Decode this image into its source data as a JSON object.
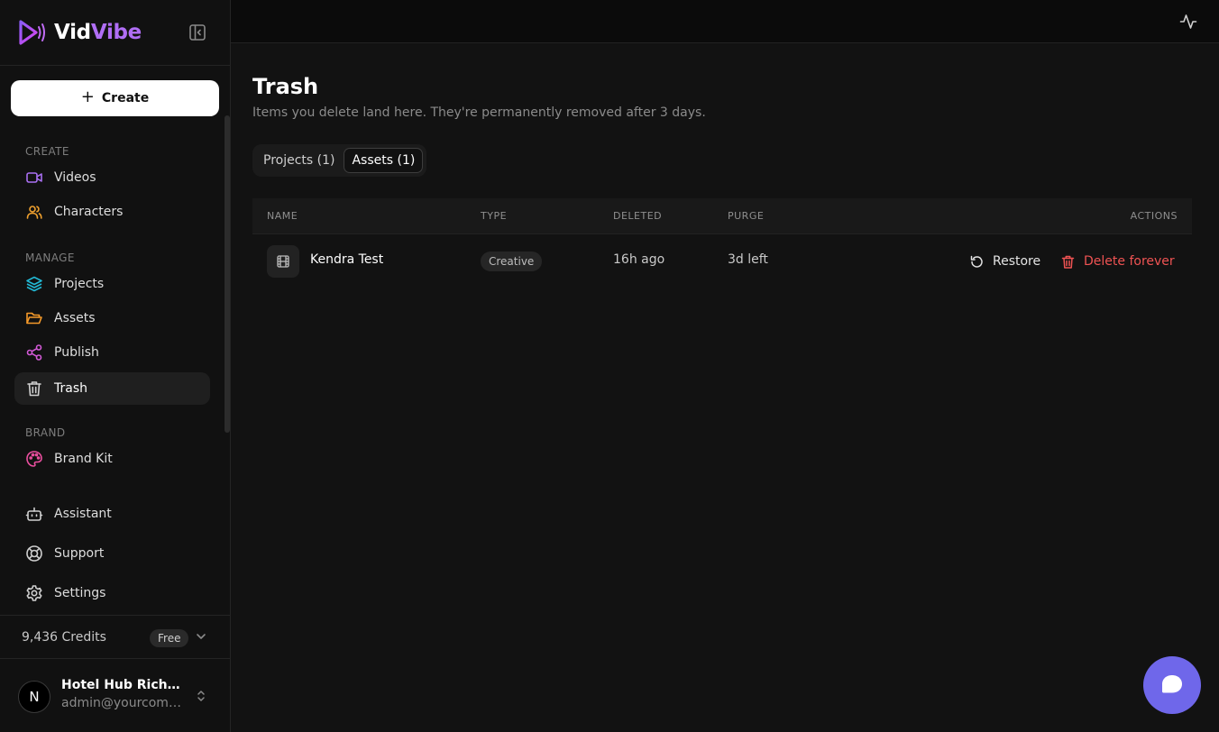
{
  "brand": {
    "name_part1": "Vid",
    "name_part2": "Vibe",
    "accent": "#b06ef5"
  },
  "sidebar": {
    "create_label": "Create",
    "sections": {
      "create": "CREATE",
      "manage": "MANAGE",
      "brand": "BRAND"
    },
    "items": {
      "videos": {
        "label": "Videos",
        "icon": "video-camera-icon",
        "color": "#a970f2"
      },
      "characters": {
        "label": "Characters",
        "icon": "users-icon",
        "color": "#f0a12e"
      },
      "projects": {
        "label": "Projects",
        "icon": "layers-icon",
        "color": "#22b8d4"
      },
      "assets": {
        "label": "Assets",
        "icon": "folder-open-icon",
        "color": "#f59a2a"
      },
      "publish": {
        "label": "Publish",
        "icon": "share-icon",
        "color": "#d35ad7"
      },
      "trash": {
        "label": "Trash",
        "icon": "trash-icon",
        "color": "#cfcfcf"
      },
      "brand_kit": {
        "label": "Brand Kit",
        "icon": "palette-icon",
        "color": "#ec4fa0"
      },
      "assistant": {
        "label": "Assistant",
        "icon": "bot-icon",
        "color": "#cfcfcf"
      },
      "support": {
        "label": "Support",
        "icon": "life-buoy-icon",
        "color": "#cfcfcf"
      },
      "settings": {
        "label": "Settings",
        "icon": "gear-icon",
        "color": "#cfcfcf"
      }
    },
    "credits": "9,436 Credits",
    "plan": "Free",
    "user": {
      "avatar_letter": "N",
      "name": "Hotel Hub Richardson",
      "email": "admin@yourcompany.com"
    }
  },
  "main": {
    "title": "Trash",
    "subtitle": "Items you delete land here. They're permanently removed after 3 days.",
    "tabs": [
      {
        "label": "Projects (1)",
        "active": false
      },
      {
        "label": "Assets (1)",
        "active": true
      }
    ],
    "table": {
      "headers": {
        "name": "NAME",
        "type": "TYPE",
        "deleted": "DELETED",
        "purge": "PURGE",
        "actions": "ACTIONS"
      },
      "rows": [
        {
          "name": "Kendra Test",
          "type": "Creative",
          "deleted": "16h ago",
          "purge": "3d left",
          "restore": "Restore",
          "delete": "Delete forever"
        }
      ]
    }
  },
  "fab_color": "#6f67ea"
}
